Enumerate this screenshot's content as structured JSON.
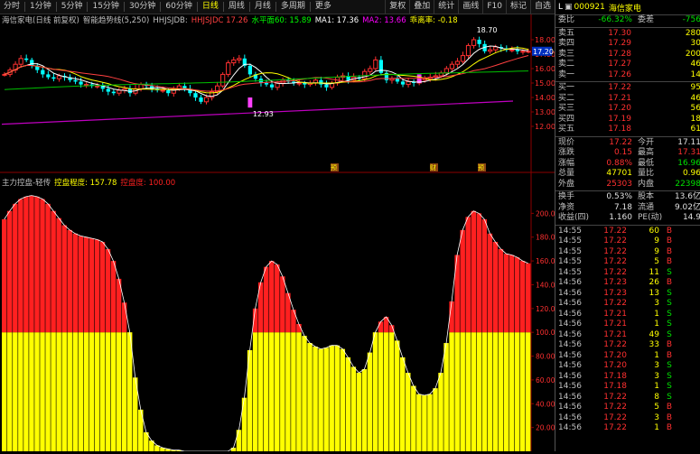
{
  "toolbar": {
    "items": [
      "分时",
      "1分钟",
      "5分钟",
      "15分钟",
      "30分钟",
      "60分钟",
      "日线",
      "周线",
      "月线",
      "多周期",
      "更多"
    ],
    "active_index": 6,
    "right_items": [
      "复权",
      "叠加",
      "统计",
      "画线",
      "F10",
      "标记",
      "自选"
    ]
  },
  "main_chart": {
    "stock_name": "海信家电(日线 前复权)",
    "indicator_name": "智能趋势线(5,250)",
    "series_labels": [
      {
        "text": "HHJSJDB:",
        "color": "#c0c0c0"
      },
      {
        "text": "HHJSJDC 17.26",
        "color": "#ff4040"
      },
      {
        "text": "水平面60: 15.89",
        "color": "#00ff00"
      },
      {
        "text": "MA1: 17.36",
        "color": "#ffffff"
      },
      {
        "text": "MA2: 13.66",
        "color": "#ff00ff"
      },
      {
        "text": "乖离率: -0.18",
        "color": "#ffff00"
      }
    ],
    "price_labels": [
      "18.00",
      "17.00",
      "16.00",
      "15.00",
      "14.00",
      "13.00",
      "12.00"
    ],
    "current_price_tag": "17.20",
    "high_label": "18.70",
    "low_label": "12.93",
    "event_markers": [
      "预",
      "财",
      "预"
    ]
  },
  "chart_data": {
    "type": "bar",
    "title": "主力控盘-轻传",
    "legend": [
      {
        "text": "控盘程度: 157.78",
        "color": "#ffff00"
      },
      {
        "text": "控盘度: 100.00",
        "color": "#ff2020"
      }
    ],
    "ylim": [
      0,
      220
    ],
    "yticks": [
      20,
      40,
      60,
      80,
      100,
      120,
      140,
      160,
      180,
      200
    ],
    "threshold": 100,
    "values": [
      195,
      202,
      208,
      212,
      214,
      215,
      214,
      212,
      208,
      202,
      196,
      190,
      186,
      183,
      181,
      180,
      179,
      178,
      176,
      170,
      160,
      145,
      125,
      100,
      62,
      35,
      16,
      9,
      5,
      3,
      2,
      1,
      1,
      0,
      0,
      0,
      0,
      0,
      0,
      0,
      0,
      0,
      3,
      18,
      45,
      85,
      120,
      142,
      155,
      160,
      157,
      147,
      133,
      119,
      107,
      97,
      91,
      88,
      86,
      87,
      89,
      89,
      86,
      79,
      71,
      66,
      69,
      83,
      100,
      109,
      113,
      106,
      93,
      79,
      66,
      55,
      48,
      47,
      48,
      53,
      66,
      91,
      126,
      165,
      186,
      197,
      202,
      200,
      195,
      183,
      176,
      170,
      166,
      165,
      163,
      160,
      158
    ]
  },
  "quote": {
    "code": "000921",
    "name": "海信家电",
    "prefix": "L",
    "weibi_label": "委比",
    "weibi_value": "-66.32%",
    "weicha_label": "委差",
    "weicha_value": "-756",
    "sells": [
      {
        "label": "卖五",
        "price": "17.30",
        "vol": "280"
      },
      {
        "label": "卖四",
        "price": "17.29",
        "vol": "30"
      },
      {
        "label": "卖三",
        "price": "17.28",
        "vol": "200"
      },
      {
        "label": "卖二",
        "price": "17.27",
        "vol": "46"
      },
      {
        "label": "卖一",
        "price": "17.26",
        "vol": "14"
      }
    ],
    "buys": [
      {
        "label": "买一",
        "price": "17.22",
        "vol": "95"
      },
      {
        "label": "买二",
        "price": "17.21",
        "vol": "46"
      },
      {
        "label": "买三",
        "price": "17.20",
        "vol": "56"
      },
      {
        "label": "买四",
        "price": "17.19",
        "vol": "18"
      },
      {
        "label": "买五",
        "price": "17.18",
        "vol": "61"
      }
    ],
    "stats": [
      {
        "l1": "现价",
        "v1": "17.22",
        "c1": "red",
        "l2": "今开",
        "v2": "17.11",
        "c2": "white"
      },
      {
        "l1": "涨跌",
        "v1": "0.15",
        "c1": "red",
        "l2": "最高",
        "v2": "17.31",
        "c2": "red"
      },
      {
        "l1": "涨幅",
        "v1": "0.88%",
        "c1": "red",
        "l2": "最低",
        "v2": "16.96",
        "c2": "green"
      },
      {
        "l1": "总量",
        "v1": "47701",
        "c1": "yellow",
        "l2": "量比",
        "v2": "0.96",
        "c2": "yellow"
      },
      {
        "l1": "外盘",
        "v1": "25303",
        "c1": "red",
        "l2": "内盘",
        "v2": "22398",
        "c2": "green"
      }
    ],
    "fundamentals": [
      {
        "l1": "换手",
        "v1": "0.53%",
        "l2": "股本",
        "v2": "13.6亿"
      },
      {
        "l1": "净资",
        "v1": "7.18",
        "l2": "流通",
        "v2": "9.02亿"
      },
      {
        "l1": "收益(四)",
        "v1": "1.160",
        "l2": "PE(动)",
        "v2": "14.9"
      }
    ],
    "ticks": [
      {
        "t": "14:55",
        "p": "17.22",
        "v": "60",
        "d": "B"
      },
      {
        "t": "14:55",
        "p": "17.22",
        "v": "9",
        "d": "B"
      },
      {
        "t": "14:55",
        "p": "17.22",
        "v": "9",
        "d": "B"
      },
      {
        "t": "14:55",
        "p": "17.22",
        "v": "5",
        "d": "B"
      },
      {
        "t": "14:55",
        "p": "17.22",
        "v": "11",
        "d": "S"
      },
      {
        "t": "14:56",
        "p": "17.23",
        "v": "26",
        "d": "B"
      },
      {
        "t": "14:56",
        "p": "17.23",
        "v": "13",
        "d": "S"
      },
      {
        "t": "14:56",
        "p": "17.22",
        "v": "3",
        "d": "S"
      },
      {
        "t": "14:56",
        "p": "17.21",
        "v": "1",
        "d": "S"
      },
      {
        "t": "14:56",
        "p": "17.21",
        "v": "1",
        "d": "S"
      },
      {
        "t": "14:56",
        "p": "17.21",
        "v": "49",
        "d": "S"
      },
      {
        "t": "14:56",
        "p": "17.22",
        "v": "33",
        "d": "B"
      },
      {
        "t": "14:56",
        "p": "17.20",
        "v": "1",
        "d": "B"
      },
      {
        "t": "14:56",
        "p": "17.20",
        "v": "3",
        "d": "S"
      },
      {
        "t": "14:56",
        "p": "17.18",
        "v": "3",
        "d": "S"
      },
      {
        "t": "14:56",
        "p": "17.18",
        "v": "1",
        "d": "S"
      },
      {
        "t": "14:56",
        "p": "17.22",
        "v": "8",
        "d": "S"
      },
      {
        "t": "14:56",
        "p": "17.22",
        "v": "5",
        "d": "B"
      },
      {
        "t": "14:56",
        "p": "17.22",
        "v": "3",
        "d": "B"
      },
      {
        "t": "14:56",
        "p": "17.22",
        "v": "1",
        "d": "B"
      }
    ]
  }
}
